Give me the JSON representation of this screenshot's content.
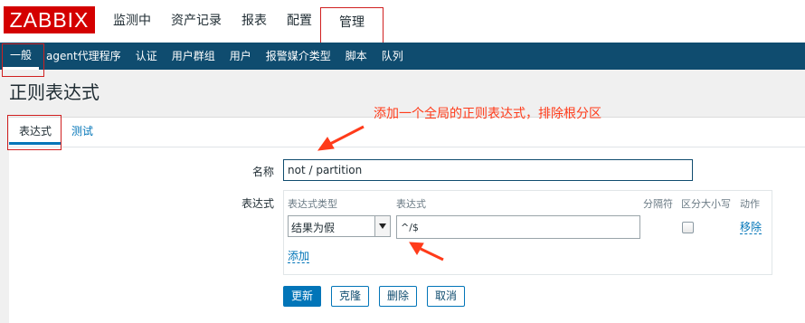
{
  "header": {
    "logo": "ZABBIX",
    "menu": [
      "监测中",
      "资产记录",
      "报表",
      "配置",
      "管理"
    ],
    "active_menu": "管理"
  },
  "submenu": {
    "items": [
      "一般",
      "agent代理程序",
      "认证",
      "用户群组",
      "用户",
      "报警媒介类型",
      "脚本",
      "队列"
    ],
    "active": "一般"
  },
  "page": {
    "title": "正则表达式",
    "annotation": "添加一个全局的正则表达式，排除根分区"
  },
  "tabs": [
    "表达式",
    "测试"
  ],
  "form": {
    "name_label": "名称",
    "name_value": "not / partition",
    "expressions_label": "表达式",
    "columns": {
      "type": "表达式类型",
      "expression": "表达式",
      "delimiter": "分隔符",
      "case": "区分大小写",
      "action": "动作"
    },
    "row": {
      "type_value": "结果为假",
      "expression_value": "^/$",
      "case_sensitive": false,
      "action": "移除"
    },
    "add_link": "添加"
  },
  "buttons": {
    "update": "更新",
    "clone": "克隆",
    "delete": "删除",
    "cancel": "取消"
  },
  "colors": {
    "brand": "#d40000",
    "nav": "#0f4c6f",
    "accent": "#0275b8",
    "annotation": "#ff3b1a"
  }
}
